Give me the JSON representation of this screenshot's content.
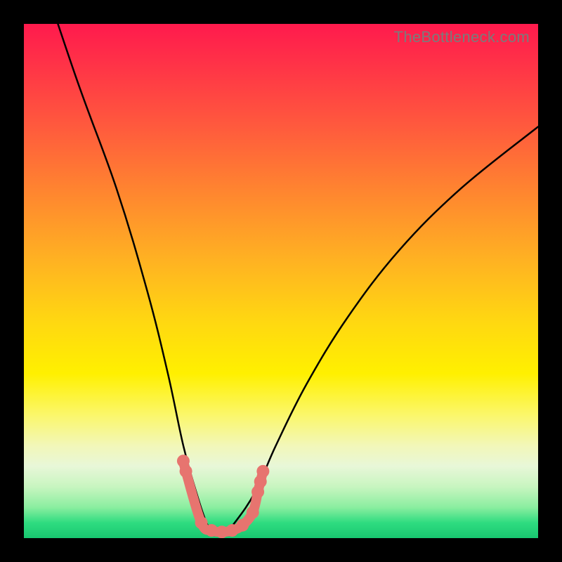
{
  "watermark": "TheBottleneck.com",
  "chart_data": {
    "type": "line",
    "title": "",
    "xlabel": "",
    "ylabel": "",
    "xlim": [
      0,
      1
    ],
    "ylim": [
      0,
      100
    ],
    "series": [
      {
        "name": "bottleneck-curve",
        "x": [
          0.0,
          0.1,
          0.18,
          0.24,
          0.28,
          0.31,
          0.335,
          0.355,
          0.37,
          0.39,
          0.41,
          0.45,
          0.49,
          0.55,
          0.63,
          0.73,
          0.85,
          1.0
        ],
        "values": [
          120,
          90,
          68,
          48,
          32,
          18,
          9,
          3,
          1,
          1,
          3,
          9,
          18,
          30,
          43,
          56,
          68,
          80
        ]
      }
    ],
    "markers": {
      "name": "highlight-points",
      "x": [
        0.31,
        0.315,
        0.345,
        0.365,
        0.385,
        0.405,
        0.425,
        0.445,
        0.455,
        0.46,
        0.465
      ],
      "values": [
        15,
        13,
        3,
        1.5,
        1.2,
        1.5,
        2.5,
        5,
        9,
        11,
        13
      ]
    },
    "colors": {
      "curve": "#000000",
      "marker_fill": "#e7746f",
      "marker_stroke": "#e7746f"
    }
  }
}
